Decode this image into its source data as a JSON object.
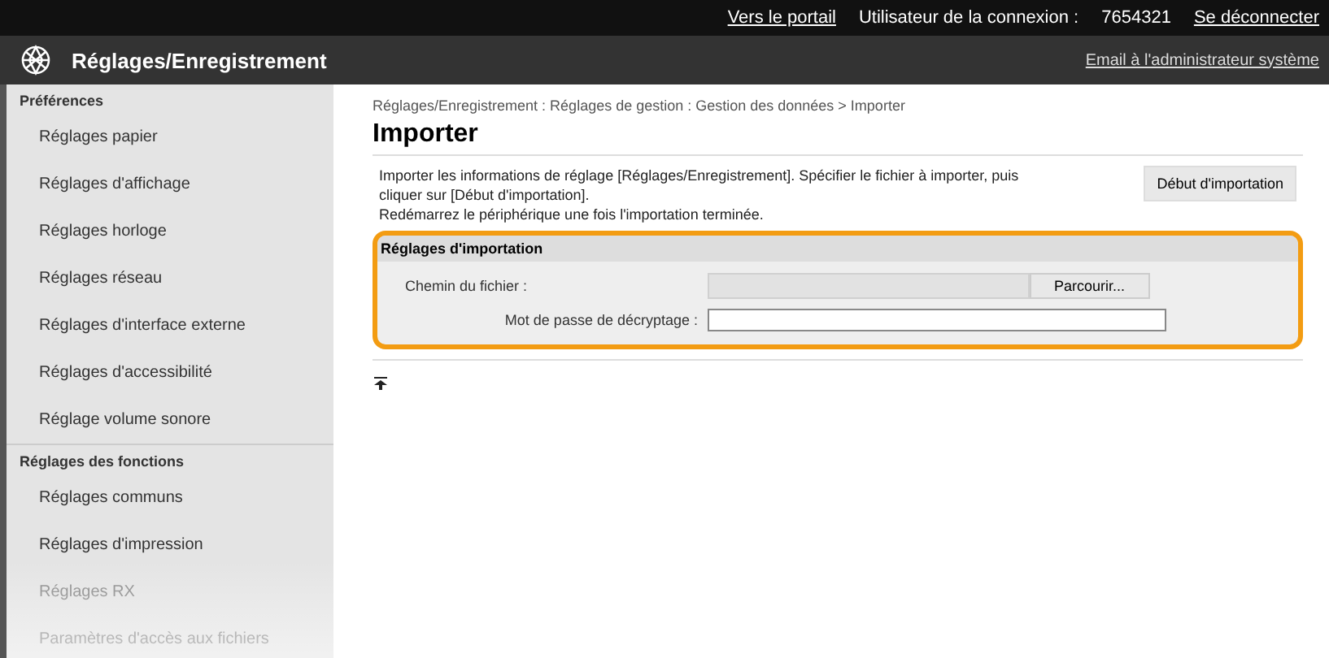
{
  "top_bar": {
    "links": [
      "Vers le portail"
    ],
    "user_label": "Utilisateur de la connexion :",
    "user_id": "7654321",
    "logout": "Se déconnecter"
  },
  "header": {
    "title": "Réglages/Enregistrement",
    "admin_link": "Email à l'administrateur système"
  },
  "sidebar": {
    "groups": [
      {
        "heading": "Préférences",
        "items": [
          {
            "label": "Réglages papier",
            "faded": false
          },
          {
            "label": "Réglages d'affichage",
            "faded": false
          },
          {
            "label": "Réglages horloge",
            "faded": false
          },
          {
            "label": "Réglages réseau",
            "faded": false
          },
          {
            "label": "Réglages d'interface externe",
            "faded": false
          },
          {
            "label": "Réglages d'accessibilité",
            "faded": false
          },
          {
            "label": "Réglage volume sonore",
            "faded": false
          }
        ]
      },
      {
        "heading": "Réglages des fonctions",
        "items": [
          {
            "label": "Réglages communs",
            "faded": false
          },
          {
            "label": "Réglages d'impression",
            "faded": false
          },
          {
            "label": "Réglages RX",
            "faded": true
          },
          {
            "label": "Paramètres d'accès aux fichiers",
            "faded": true
          }
        ]
      }
    ]
  },
  "breadcrumb": "Réglages/Enregistrement : Réglages de gestion : Gestion des données > Importer",
  "page_title": "Importer",
  "description": [
    "Importer les informations de réglage [Réglages/Enregistrement]. Spécifier le fichier à importer, puis cliquer sur [Début d'importation].",
    "Redémarrez le périphérique une fois l'importation terminée."
  ],
  "start_button": "Début d'importation",
  "section": {
    "title": "Réglages d'importation",
    "highlighted": true,
    "fields": [
      {
        "kind": "file",
        "label": "Chemin du fichier :",
        "button": "Parcourir..."
      },
      {
        "kind": "password",
        "label": "Mot de passe de décryptage :"
      }
    ]
  }
}
